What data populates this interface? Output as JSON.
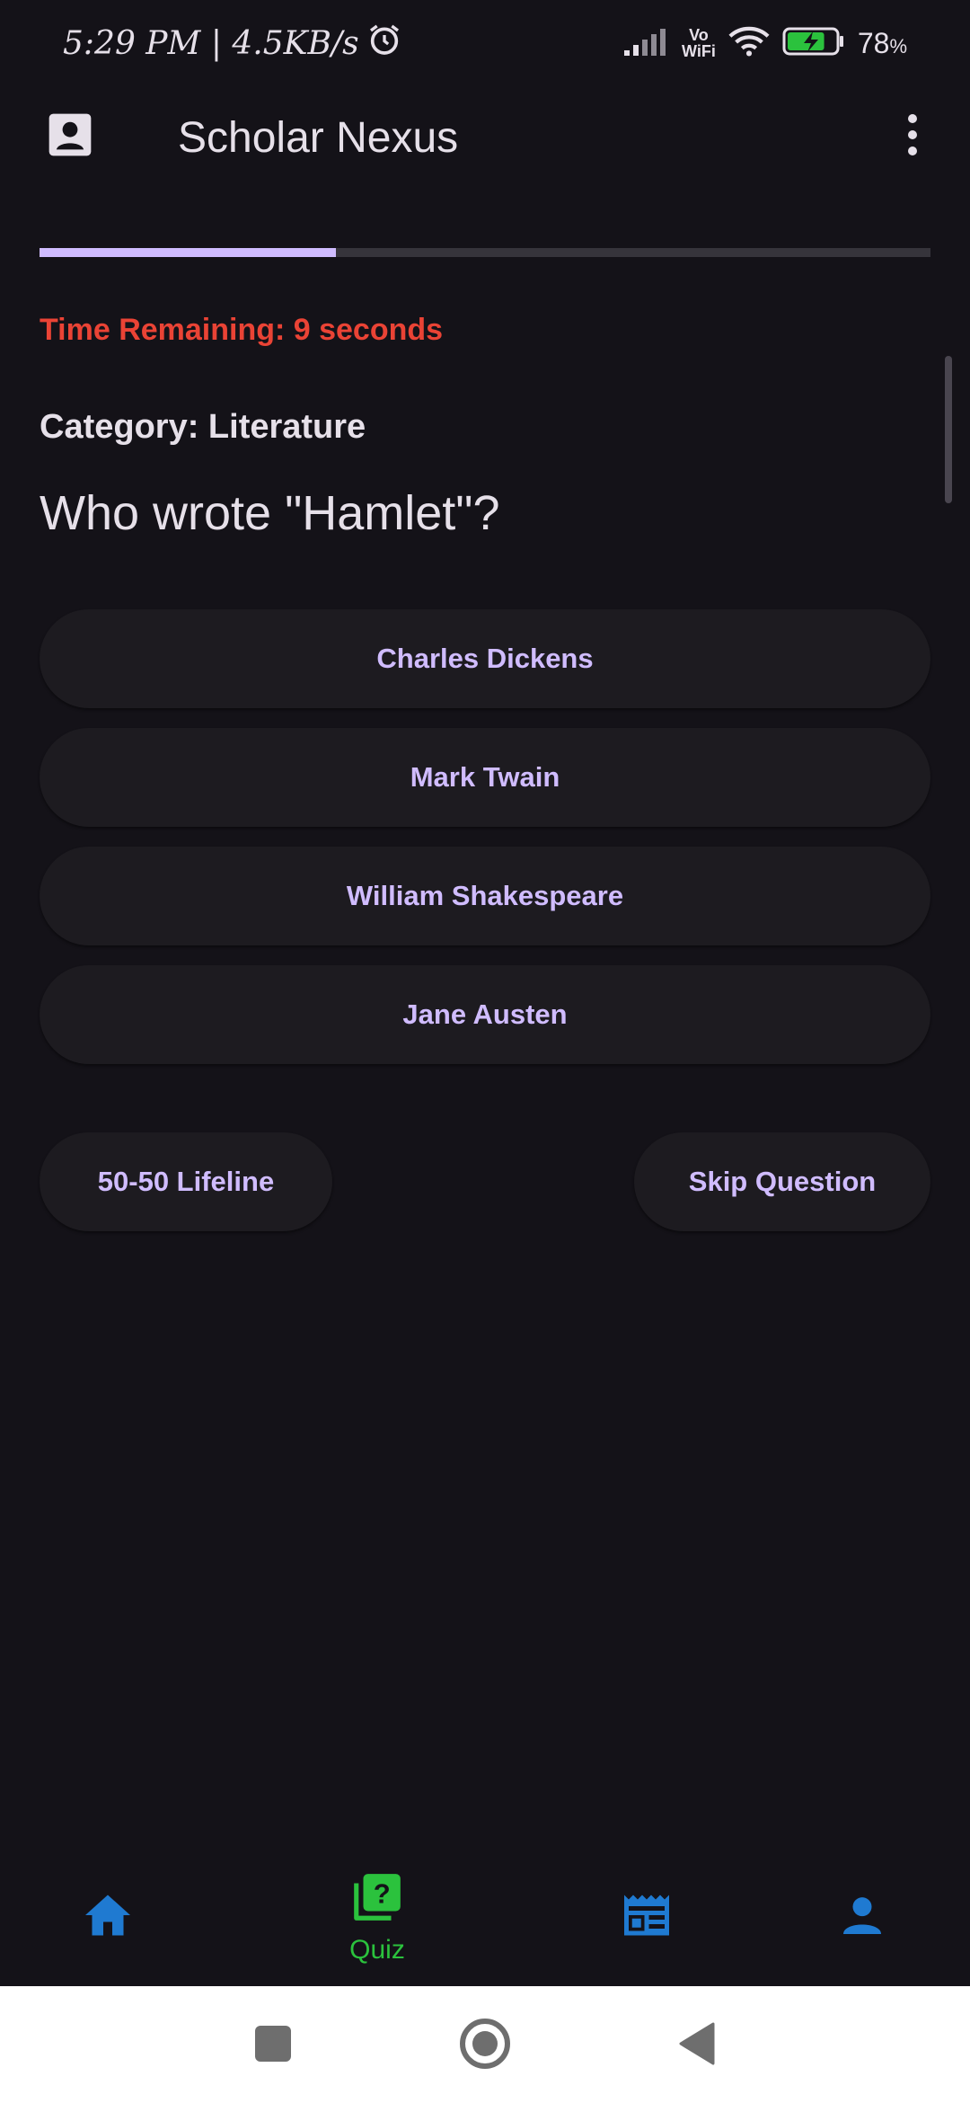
{
  "status_bar": {
    "time_speed": "5:29 PM | 4.5KB/s",
    "vowifi_top": "Vo",
    "vowifi_bottom": "WiFi",
    "battery_percent": "78",
    "battery_percent_suffix": "%",
    "battery_level": 0.78,
    "charging_color": "#2BC23D"
  },
  "app_bar": {
    "title": "Scholar Nexus",
    "account_icon": "account-box-icon",
    "menu_icon": "more-vert-icon"
  },
  "quiz": {
    "progress": 0.333,
    "progress_color": "#D0BCFF",
    "timer": "Time Remaining: 9 seconds",
    "timer_color": "#EA4335",
    "category": "Category: Literature",
    "question": "Who wrote \"Hamlet\"?",
    "answers": [
      "Charles Dickens",
      "Mark Twain",
      "William Shakespeare",
      "Jane Austen"
    ],
    "lifeline_label": "50-50 Lifeline",
    "skip_label": "Skip Question"
  },
  "bottom_nav": {
    "items": [
      {
        "icon": "home-icon",
        "label": ""
      },
      {
        "icon": "quiz-icon",
        "label": "Quiz",
        "selected": true
      },
      {
        "icon": "news-icon",
        "label": ""
      },
      {
        "icon": "person-icon",
        "label": ""
      }
    ],
    "icon_color": "#1F7AD1",
    "selected_color": "#2BC23D"
  },
  "system_nav": {
    "recents_icon": "square-icon",
    "home_icon": "circle-icon",
    "back_icon": "triangle-back-icon"
  }
}
